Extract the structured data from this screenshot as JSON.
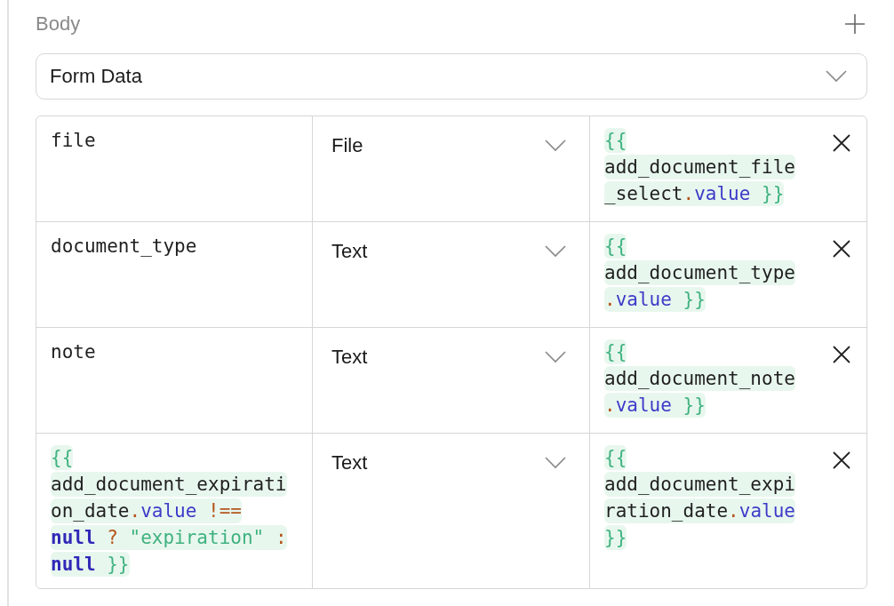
{
  "section": {
    "title": "Body"
  },
  "body_type": {
    "value": "Form Data"
  },
  "rows": [
    {
      "key": {
        "kind": "text",
        "text": "file"
      },
      "type": "File",
      "value": [
        {
          "kind": "brace",
          "text": "{{ "
        },
        {
          "kind": "ident",
          "text": "add_document_file_select"
        },
        {
          "kind": "punct",
          "text": "."
        },
        {
          "kind": "prop",
          "text": "value"
        },
        {
          "kind": "brace",
          "text": " }}"
        }
      ]
    },
    {
      "key": {
        "kind": "text",
        "text": "document_type"
      },
      "type": "Text",
      "value": [
        {
          "kind": "brace",
          "text": "{{ "
        },
        {
          "kind": "ident",
          "text": "add_document_type"
        },
        {
          "kind": "punct",
          "text": "."
        },
        {
          "kind": "prop",
          "text": "value"
        },
        {
          "kind": "brace",
          "text": " }}"
        }
      ]
    },
    {
      "key": {
        "kind": "text",
        "text": "note"
      },
      "type": "Text",
      "value": [
        {
          "kind": "brace",
          "text": "{{ "
        },
        {
          "kind": "ident",
          "text": "add_document_note"
        },
        {
          "kind": "punct",
          "text": "."
        },
        {
          "kind": "prop",
          "text": "value"
        },
        {
          "kind": "brace",
          "text": " }}"
        }
      ]
    },
    {
      "key": {
        "kind": "template",
        "tokens": [
          {
            "kind": "brace",
            "text": "{{ "
          },
          {
            "kind": "ident",
            "text": "add_document_expiration_date"
          },
          {
            "kind": "punct",
            "text": "."
          },
          {
            "kind": "prop",
            "text": "value"
          },
          {
            "kind": "punct",
            "text": " !== "
          },
          {
            "kind": "keyword",
            "text": "null"
          },
          {
            "kind": "punct",
            "text": " ? "
          },
          {
            "kind": "string",
            "text": "\"expiration\""
          },
          {
            "kind": "punct",
            "text": " : "
          },
          {
            "kind": "keyword",
            "text": "null"
          },
          {
            "kind": "brace",
            "text": " }}"
          }
        ]
      },
      "type": "Text",
      "value": [
        {
          "kind": "brace",
          "text": "{{ "
        },
        {
          "kind": "ident",
          "text": "add_document_expiration_date"
        },
        {
          "kind": "punct",
          "text": "."
        },
        {
          "kind": "prop",
          "text": "value"
        },
        {
          "kind": "brace",
          "text": " }}"
        }
      ]
    }
  ]
}
